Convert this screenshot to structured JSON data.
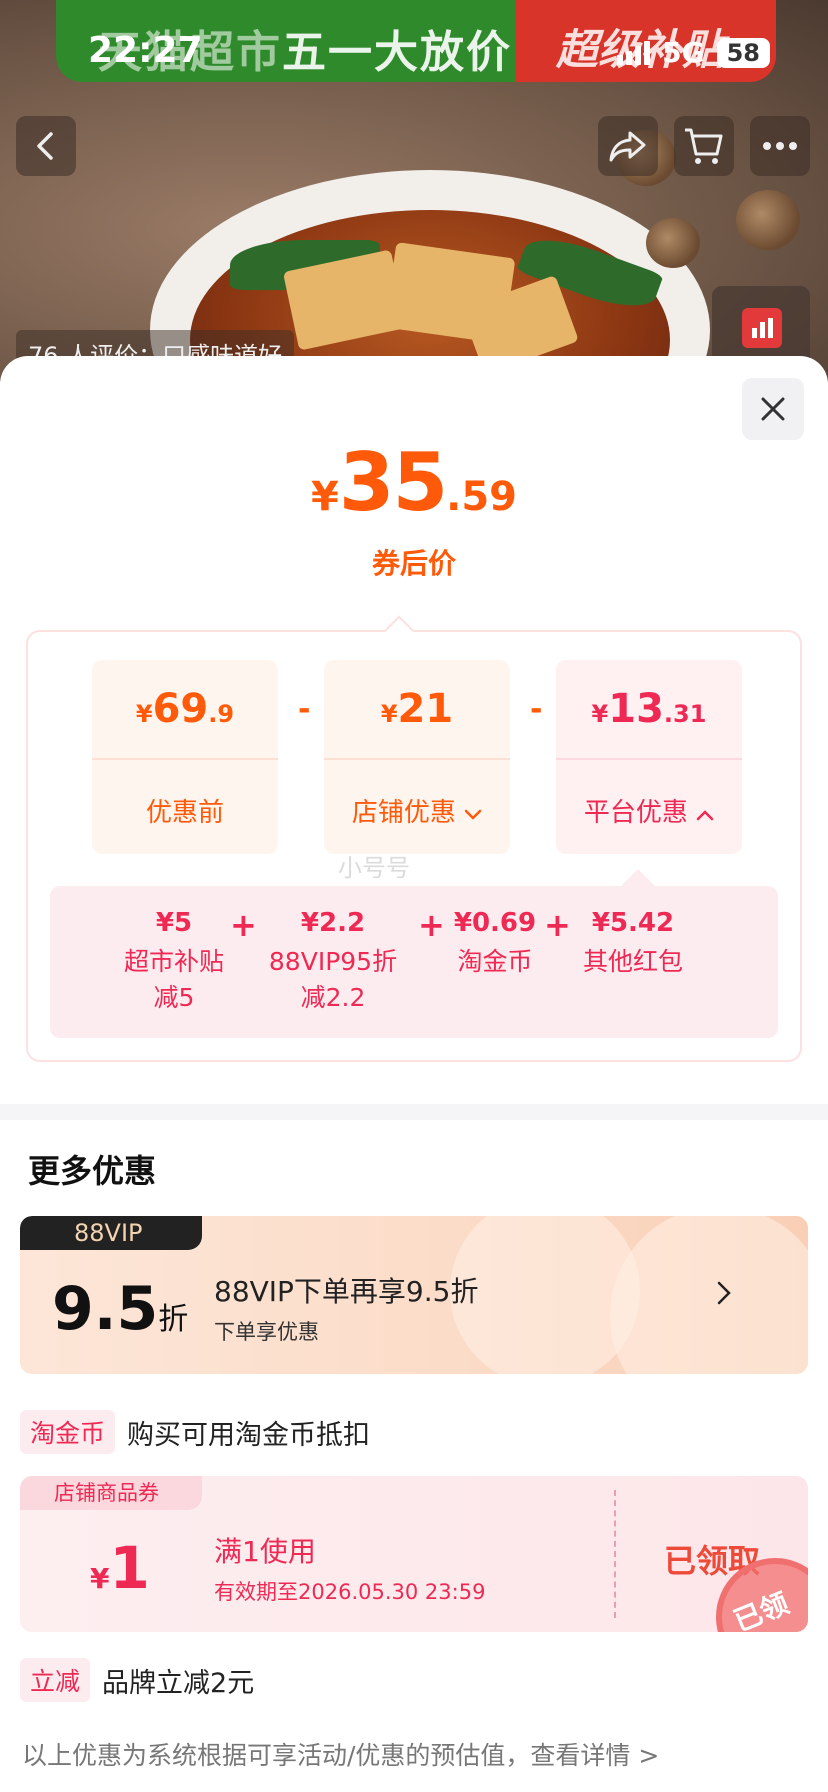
{
  "banner": {
    "left_text_faded": "天猫超市",
    "left_text_bold": "五一大放价",
    "right_text": "超级补贴"
  },
  "status_bar": {
    "time": "22:27",
    "network": "5G",
    "battery": "58"
  },
  "hero": {
    "review_text": "76 人评价：口感味道好"
  },
  "price": {
    "currency": "¥",
    "integer": "35",
    "decimal": ".59",
    "caption": "券后价"
  },
  "breakdown": {
    "minus_sign": "-",
    "original": {
      "currency": "¥",
      "integer": "69",
      "decimal": ".9",
      "label": "优惠前"
    },
    "shop": {
      "currency": "¥",
      "integer": "21",
      "decimal": "",
      "label": "店铺优惠"
    },
    "platform": {
      "currency": "¥",
      "integer": "13",
      "decimal": ".31",
      "label": "平台优惠"
    },
    "watermark": "小号号",
    "plus_sign": "+",
    "subsidies": [
      {
        "amount": "¥5",
        "name_line1": "超市补贴",
        "name_line2": "减5"
      },
      {
        "amount": "¥2.2",
        "name_line1": "88VIP95折",
        "name_line2": "减2.2"
      },
      {
        "amount": "¥0.69",
        "name_line1": "淘金币",
        "name_line2": ""
      },
      {
        "amount": "¥5.42",
        "name_line1": "其他红包",
        "name_line2": ""
      }
    ]
  },
  "more": {
    "title": "更多优惠",
    "vip": {
      "tag": "88VIP",
      "discount": "9.5",
      "discount_unit": "折",
      "title": "88VIP下单再享9.5折",
      "desc": "下单享优惠"
    },
    "coin": {
      "chip": "淘金币",
      "text": "购买可用淘金币抵扣"
    },
    "coupon": {
      "tag": "店铺商品券",
      "currency": "¥",
      "amount": "1",
      "condition": "满1使用",
      "expiry": "有效期至2026.05.30 23:59",
      "status": "已领取",
      "stamp": "已领"
    },
    "instant": {
      "chip": "立减",
      "text": "品牌立减2元"
    }
  },
  "footer": {
    "note": "以上优惠为系统根据可享活动/优惠的预估值，查看详情 >"
  },
  "colors": {
    "orange": "#ff5a0a",
    "red": "#ee2a54",
    "banner_green": "#2f8a2c",
    "banner_red": "#d8342a"
  }
}
